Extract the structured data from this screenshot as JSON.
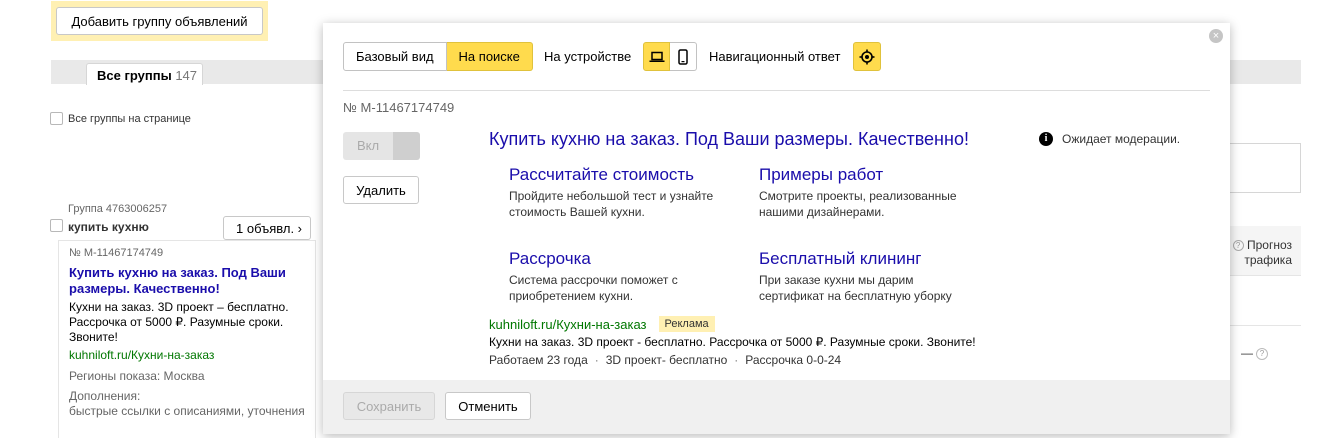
{
  "toolbar": {
    "add_group_label": "Добавить группу объявлений"
  },
  "tabs": {
    "all_label": "Все группы",
    "all_count": "147"
  },
  "select_all_label": "Все группы на странице",
  "table": {
    "forecast_label": "Прогноз трафика",
    "forecast_help": "?",
    "row_value": "—",
    "row_help": "?"
  },
  "group": {
    "id_text": "Группа 4763006257",
    "name": "купить кухню",
    "ads_count_label": "1 объявл. ›"
  },
  "ad_card": {
    "number": "№ M-11467174749",
    "title": "Купить кухню на заказ. Под Ваши размеры. Качественно!",
    "text": "Кухни на заказ. 3D проект – бесплатно. Рассрочка от 5000 ₽. Разумные сроки. Звоните!",
    "url": "kuhniloft.ru/Кухни-на-заказ",
    "regions": "Регионы показа: Москва",
    "extras_label": "Дополнения:",
    "extras": "быстрые ссылки с описаниями, уточнения"
  },
  "modal": {
    "close_glyph": "×",
    "view_basic": "Базовый вид",
    "view_search": "На поиске",
    "device_label": "На устройстве",
    "nav_answer_label": "Навигационный ответ",
    "ad_number": "№ M-11467174749",
    "toggle_on": "Вкл",
    "delete_label": "Удалить",
    "moderation_icon": "i",
    "moderation_status": "Ожидает модерации.",
    "serp": {
      "title": "Купить кухню на заказ. Под Ваши размеры. Качественно!",
      "sitelinks": [
        {
          "title": "Рассчитайте стоимость",
          "desc": "Пройдите небольшой тест и узнайте стоимость Вашей кухни."
        },
        {
          "title": "Примеры работ",
          "desc": "Смотрите проекты, реализованные нашими дизайнерами."
        },
        {
          "title": "Рассрочка",
          "desc": "Система рассрочки поможет с приобретением кухни."
        },
        {
          "title": "Бесплатный клининг",
          "desc": "При заказе кухни мы дарим сертификат на бесплатную уборку"
        }
      ],
      "url": "kuhniloft.ru/Кухни-на-заказ",
      "ad_badge": "Реклама",
      "text": "Кухни на заказ. 3D проект - бесплатно. Рассрочка от 5000 ₽. Разумные сроки. Звоните!",
      "callouts": [
        "Работаем 23 года",
        "3D проект- бесплатно",
        "Рассрочка 0-0-24"
      ],
      "callout_sep": "·"
    },
    "save_label": "Сохранить",
    "cancel_label": "Отменить"
  },
  "colors": {
    "accent_yellow": "#ffdb4d",
    "highlight_yellow": "#fff0b3",
    "link_blue": "#1a0dab",
    "url_green": "#007700"
  }
}
